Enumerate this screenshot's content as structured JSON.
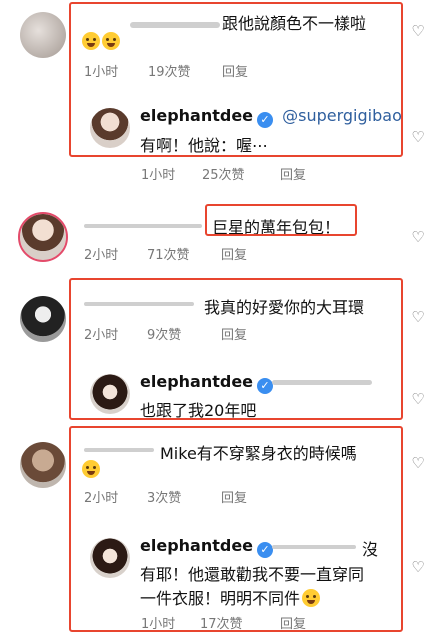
{
  "comments": [
    {
      "text": "跟他說顏色不一樣啦",
      "emoji": "😂😂",
      "time": "1小时",
      "likes": "19次赞",
      "reply_label": "回复",
      "reply": {
        "username": "elephantdee",
        "mention": "@supergigibao",
        "text": "有啊！他說：喔⋯",
        "time": "1小时",
        "likes": "25次赞",
        "reply_label": "回复"
      }
    },
    {
      "text": "巨星的萬年包包！",
      "time": "2小时",
      "likes": "71次赞",
      "reply_label": "回复"
    },
    {
      "text": "我真的好愛你的大耳環",
      "time": "2小时",
      "likes": "9次赞",
      "reply_label": "回复",
      "reply": {
        "username": "elephantdee",
        "text": "也跟了我20年吧"
      }
    },
    {
      "text": "Mike有不穿緊身衣的時候嗎",
      "emoji": "😂",
      "time": "2小时",
      "likes": "3次赞",
      "reply_label": "回复",
      "reply": {
        "username": "elephantdee",
        "suffix": "沒",
        "text_line1": "有耶！他還敢勸我不要一直穿同",
        "text_line2": "一件衣服！明明不同件",
        "emoji": "😤",
        "time": "1小时",
        "likes": "17次赞",
        "reply_label": "回复"
      }
    }
  ],
  "colors": {
    "highlight_box": "#e8452f",
    "mention": "#2f5f9e",
    "verified": "#3a8ef0"
  },
  "icons": {
    "like": "heart-outline-icon",
    "verified": "verified-badge-icon"
  }
}
